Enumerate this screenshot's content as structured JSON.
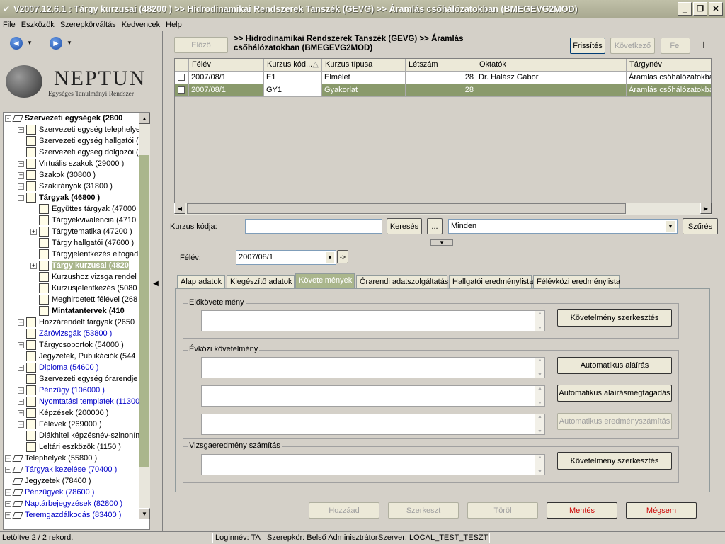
{
  "window": {
    "title": "V2007.12.6.1 : Tárgy kurzusai (48200  )  >> Hidrodinamikai Rendszerek Tanszék (GEVG) >> Áramlás csőhálózatokban (BMEGEVG2MOD)"
  },
  "menu": [
    "File",
    "Eszközök",
    "Szerepkörváltás",
    "Kedvencek",
    "Help"
  ],
  "logo": {
    "title": "NEPTUN",
    "subtitle": "Egységes Tanulmányi Rendszer"
  },
  "tree": [
    {
      "label": "Szervezeti egységek (2800",
      "bold": true,
      "exp": "−"
    },
    {
      "label": "Szervezeti egység telephelye",
      "exp": "+"
    },
    {
      "label": "Szervezeti egység hallgatói (",
      "exp": ""
    },
    {
      "label": "Szervezeti egység dolgozói (",
      "exp": ""
    },
    {
      "label": "Virtuális szakok (29000  )",
      "exp": "+"
    },
    {
      "label": "Szakok (30800  )",
      "exp": "+"
    },
    {
      "label": "Szakirányok (31800  )",
      "exp": "+"
    },
    {
      "label": "Tárgyak (46800  )",
      "bold": true,
      "exp": "−"
    },
    {
      "label": "Együttes tárgyak (47000",
      "exp": ""
    },
    {
      "label": "Tárgyekvivalencia (4710",
      "exp": ""
    },
    {
      "label": "Tárgytematika (47200  )",
      "exp": "+"
    },
    {
      "label": "Tárgy hallgatói (47600  )",
      "exp": ""
    },
    {
      "label": "Tárgyjelentkezés elfogad",
      "exp": ""
    },
    {
      "label": "Tárgy kurzusai (4820",
      "bold": true,
      "sel": true,
      "exp": "+"
    },
    {
      "label": "Kurzushoz vizsga rendel",
      "exp": ""
    },
    {
      "label": "Kurzusjelentkezés (5080",
      "exp": ""
    },
    {
      "label": "Meghirdetett félévei (268",
      "exp": ""
    },
    {
      "label": "Mintatantervek (410",
      "bold": true,
      "exp": ""
    },
    {
      "label": "Hozzárendelt tárgyak (2650",
      "exp": "+"
    },
    {
      "label": "Záróvizsgák (53800  )",
      "blue": true,
      "exp": ""
    },
    {
      "label": "Tárgycsoportok (54000  )",
      "exp": "+"
    },
    {
      "label": "Jegyzetek, Publikációk (544",
      "exp": ""
    },
    {
      "label": "Diploma (54600  )",
      "blue": true,
      "exp": "+"
    },
    {
      "label": "Szervezeti egység órarendje",
      "exp": ""
    },
    {
      "label": "Pénzügy (106000  )",
      "blue": true,
      "exp": "+"
    },
    {
      "label": "Nyomtatási templatek (11300",
      "blue": true,
      "exp": "+"
    },
    {
      "label": "Képzések (200000  )",
      "exp": "+"
    },
    {
      "label": "Félévek (269000  )",
      "exp": "+"
    },
    {
      "label": "Diákhitel képzésnév-szinoním",
      "exp": ""
    },
    {
      "label": "Leltári eszközök (1150  )",
      "exp": ""
    },
    {
      "label": "Telephelyek (55800  )",
      "exp": "+"
    },
    {
      "label": "Tárgyak kezelése (70400  )",
      "blue": true,
      "exp": "+"
    },
    {
      "label": "Jegyzetek (78400  )",
      "exp": ""
    },
    {
      "label": "Pénzügyek (78600  )",
      "blue": true,
      "exp": "+"
    },
    {
      "label": "Naptárbejegyzések (82800  )",
      "blue": true,
      "exp": "+"
    },
    {
      "label": "Teremgazdálkodás (83400  )",
      "blue": true,
      "exp": "+"
    }
  ],
  "toolbar": {
    "prev": "Előző",
    "refresh": "Frissítés",
    "next": "Következő",
    "up": "Fel"
  },
  "breadcrumb": ">> Hidrodinamikai Rendszerek Tanszék (GEVG) >> Áramlás csőhálózatokban (BMEGEVG2MOD)",
  "grid": {
    "headers": [
      "Félév",
      "Kurzus kód...",
      "Kurzus típusa",
      "Létszám",
      "Oktatók",
      "Tárgynév"
    ],
    "rows": [
      [
        "2007/08/1",
        "E1",
        "Elmélet",
        "28",
        "Dr. Halász Gábor",
        "Áramlás csőhálózatokban"
      ],
      [
        "2007/08/1",
        "GY1",
        "Gyakorlat",
        "28",
        "",
        "Áramlás csőhálózatokban"
      ]
    ]
  },
  "search": {
    "label": "Kurzus kódja:",
    "value": "",
    "button": "Keresés",
    "ellipsis": "...",
    "filter": "Minden",
    "filter_button": "Szűrés"
  },
  "semester": {
    "label": "Félév:",
    "value": "2007/08/1",
    "go": "->"
  },
  "tabs": [
    "Alap adatok",
    "Kiegészítő adatok",
    "Követelmények",
    "Órarendi adatszolgáltatás",
    "Hallgatói eredménylista",
    "Félévközi eredménylista"
  ],
  "groups": {
    "pre": "Előkövetelmény",
    "mid": "Évközi követelmény",
    "exam": "Vizsgaeredmény számítás"
  },
  "buttons": {
    "req_edit": "Követelmény szerkesztés",
    "auto_sign": "Automatikus aláírás",
    "auto_deny": "Automatikus aláírásmegtagadás",
    "auto_result": "Automatikus eredményszámítás",
    "req_edit2": "Követelmény szerkesztés",
    "add": "Hozzáad",
    "edit": "Szerkeszt",
    "delete": "Töröl",
    "save": "Mentés",
    "cancel": "Mégsem"
  },
  "status": {
    "records": "Letöltve 2 / 2 rekord.",
    "login": "Loginnév: TA",
    "role": "Szerepkör: Belső Adminisztrátor",
    "server": "Szerver: LOCAL_TEST_TESZT"
  }
}
